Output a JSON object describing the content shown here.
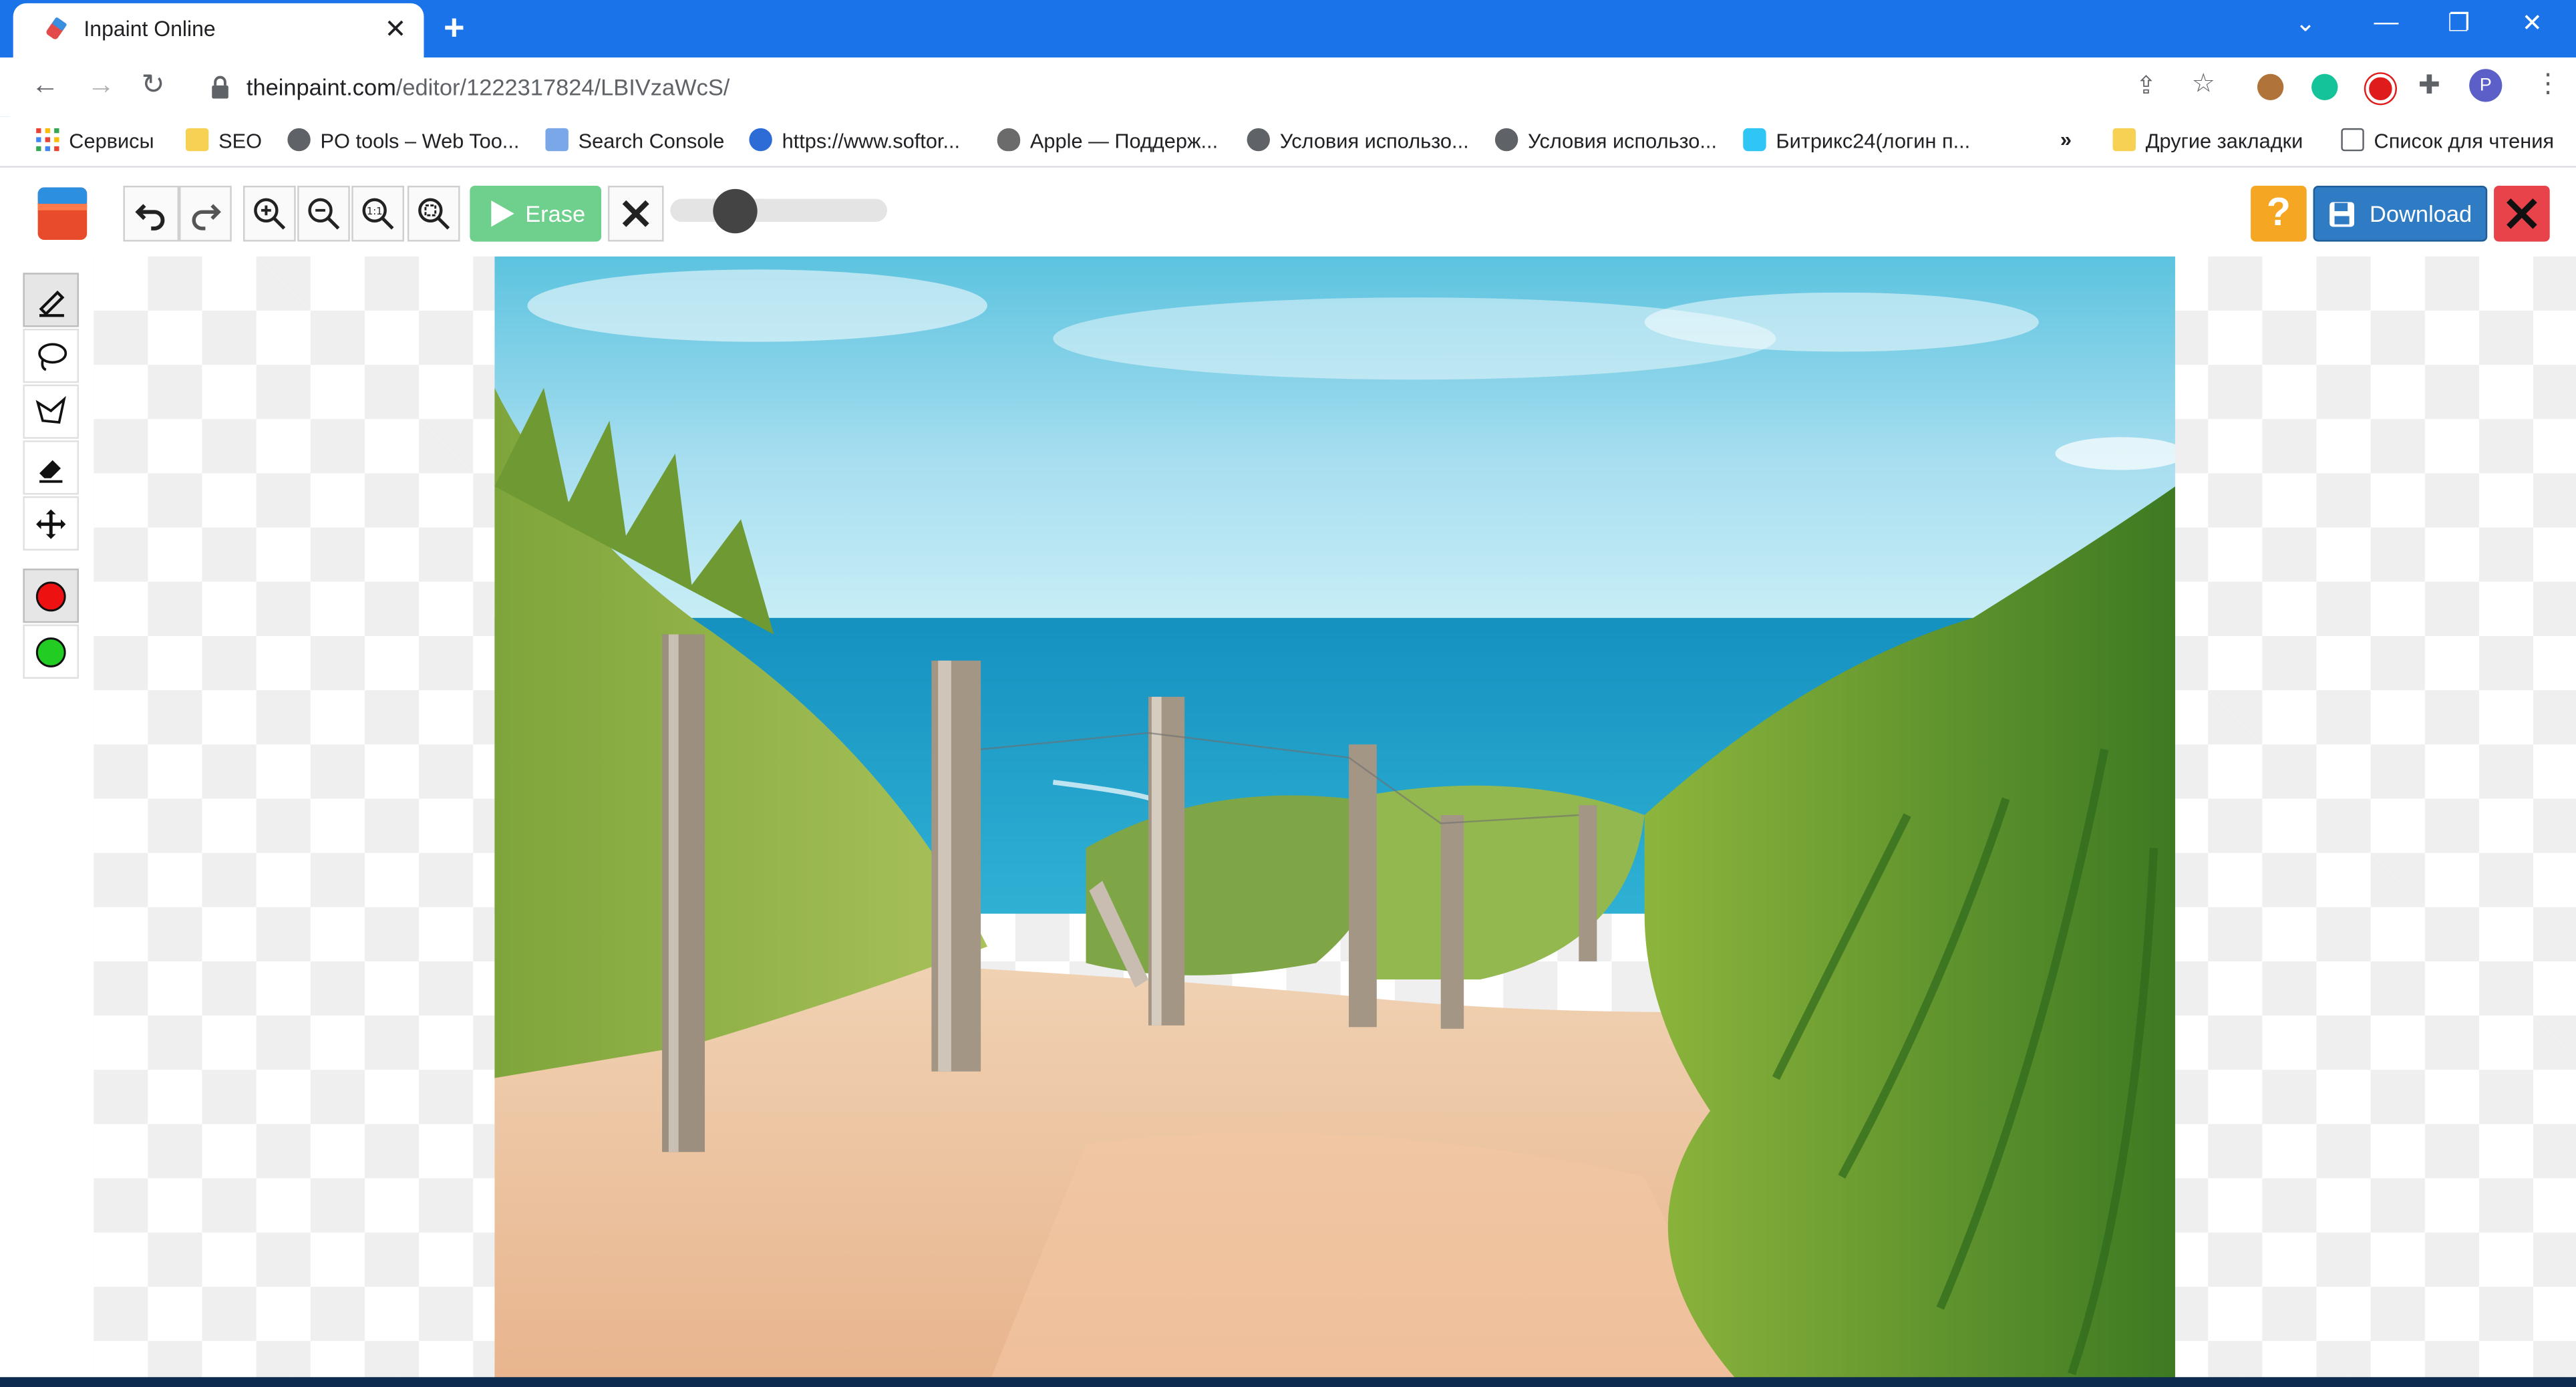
{
  "browser": {
    "tab_title": "Inpaint Online",
    "url_host": "theinpaint.com",
    "url_path": "/editor/1222317824/LBIVzaWcS/",
    "profile_initial": "P",
    "accent_color": "#1a73e8"
  },
  "bookmarks": {
    "items": [
      {
        "label": "Сервисы",
        "icon": "apps-grid-icon"
      },
      {
        "label": "SEO",
        "icon": "folder-icon"
      },
      {
        "label": "PO tools – Web Too...",
        "icon": "globe-icon"
      },
      {
        "label": "Search Console",
        "icon": "search-console-icon"
      },
      {
        "label": "https://www.softor...",
        "icon": "planet-icon"
      },
      {
        "label": "Apple — Поддерж...",
        "icon": "apple-icon"
      },
      {
        "label": "Условия использо...",
        "icon": "globe-icon"
      },
      {
        "label": "Условия использо...",
        "icon": "globe-icon"
      },
      {
        "label": "Битрикс24(логин п...",
        "icon": "bitrix-icon"
      }
    ],
    "overflow": "»",
    "other_bookmarks": "Другие закладки",
    "reading_list": "Список для чтения"
  },
  "editor": {
    "erase_label": "Erase",
    "download_label": "Download",
    "help_label": "?",
    "brush_size_fraction": 0.25,
    "tools": [
      "marker-icon",
      "lasso-icon",
      "polygon-lasso-icon",
      "eraser-icon",
      "move-icon"
    ],
    "colors": {
      "red": "#ee1111",
      "green": "#22cc22",
      "erase_button": "#6fcf8c",
      "download_button": "#2f7cc5",
      "help_button": "#f5a623",
      "close_button": "#e8434a"
    }
  }
}
